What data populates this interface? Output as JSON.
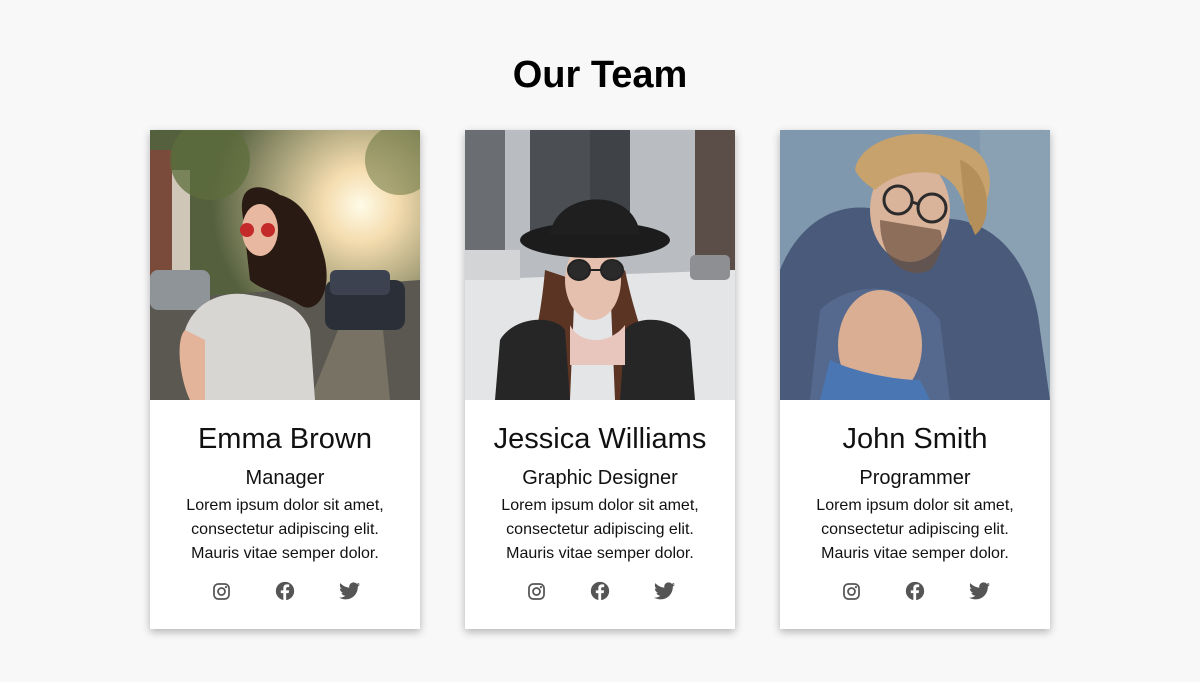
{
  "page": {
    "title": "Our Team"
  },
  "team": [
    {
      "name": "Emma Brown",
      "role": "Manager",
      "description": [
        "Lorem ipsum dolor sit amet,",
        "consectetur adipiscing elit.",
        "Mauris vitae semper dolor."
      ]
    },
    {
      "name": "Jessica Williams",
      "role": "Graphic Designer",
      "description": [
        "Lorem ipsum dolor sit amet,",
        "consectetur adipiscing elit.",
        "Mauris vitae semper dolor."
      ]
    },
    {
      "name": "John Smith",
      "role": "Programmer",
      "description": [
        "Lorem ipsum dolor sit amet,",
        "consectetur adipiscing elit.",
        "Mauris vitae semper dolor."
      ]
    }
  ],
  "social_icons": [
    "instagram-icon",
    "facebook-icon",
    "twitter-icon"
  ],
  "colors": {
    "background": "#f8f8f9",
    "card": "#ffffff",
    "icon": "#555555",
    "text": "#111111"
  }
}
